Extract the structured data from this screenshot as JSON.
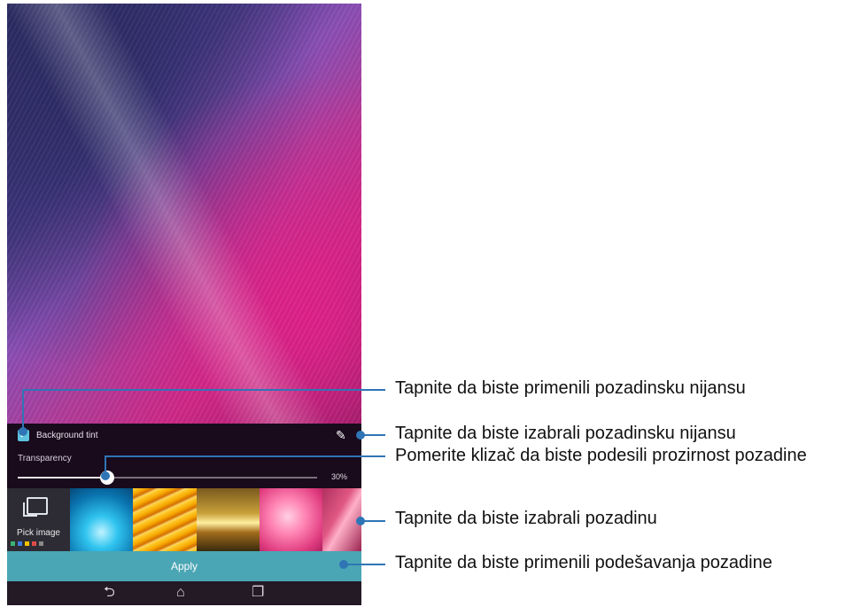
{
  "tint": {
    "checkbox_checked": true,
    "label": "Background tint",
    "pencil_icon": "pencil-icon"
  },
  "transparency": {
    "label": "Transparency",
    "value_label": "30%",
    "value": 0.3
  },
  "wallpaper_picker": {
    "pick_label": "Pick image",
    "thumbnails": [
      "water-splash",
      "yellow-rope",
      "sunset",
      "pink-flower",
      "pink-fabric"
    ]
  },
  "apply_label": "Apply",
  "navbar": {
    "icons": [
      "back-icon",
      "home-icon",
      "recents-icon"
    ]
  },
  "callouts": [
    "Tapnite da biste primenili pozadinsku nijansu",
    "Tapnite da biste izabrali pozadinsku nijansu",
    "Pomerite klizač da biste podesili prozirnost pozadine",
    "Tapnite da biste izabrali pozadinu",
    "Tapnite da biste primenili podešavanja pozadine"
  ],
  "colors": {
    "accent": "#4aa6b4",
    "checkbox": "#5ec3df",
    "callout": "#2f75b5"
  }
}
